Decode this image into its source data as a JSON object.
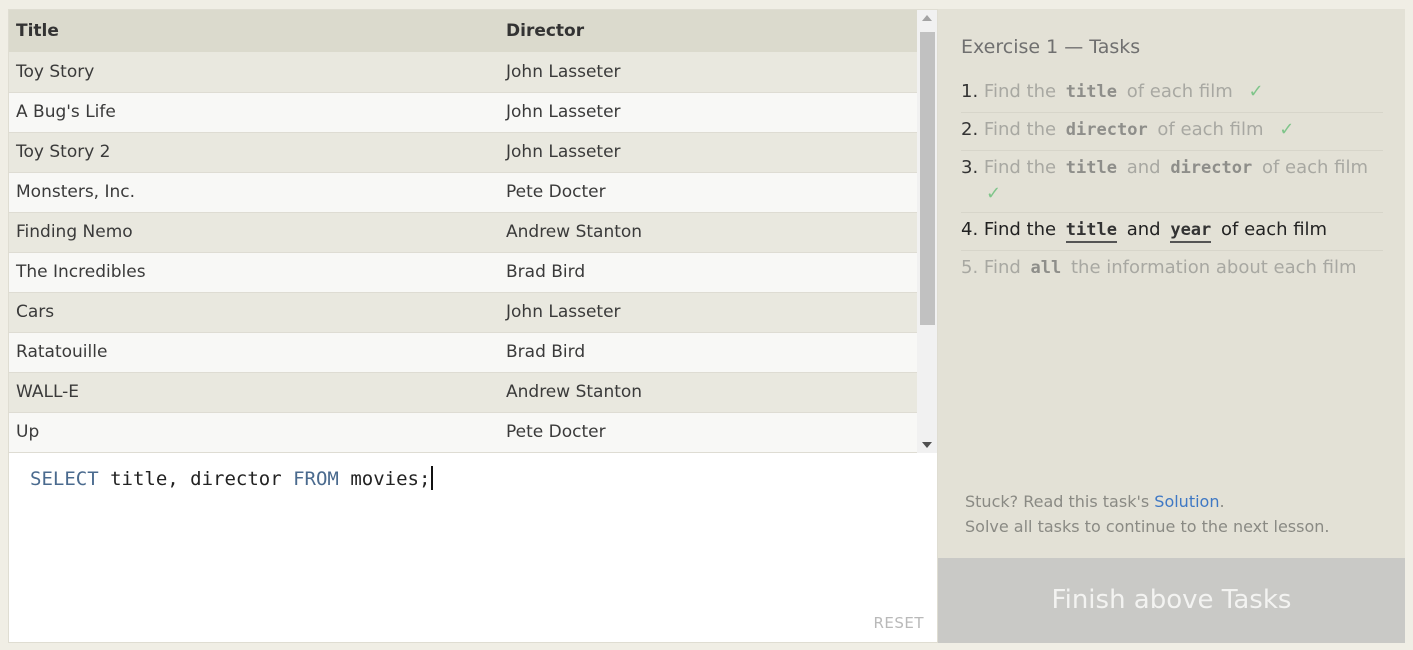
{
  "results": {
    "headers": {
      "title": "Title",
      "director": "Director"
    },
    "rows": [
      {
        "title": "Toy Story",
        "director": "John Lasseter"
      },
      {
        "title": "A Bug's Life",
        "director": "John Lasseter"
      },
      {
        "title": "Toy Story 2",
        "director": "John Lasseter"
      },
      {
        "title": "Monsters, Inc.",
        "director": "Pete Docter"
      },
      {
        "title": "Finding Nemo",
        "director": "Andrew Stanton"
      },
      {
        "title": "The Incredibles",
        "director": "Brad Bird"
      },
      {
        "title": "Cars",
        "director": "John Lasseter"
      },
      {
        "title": "Ratatouille",
        "director": "Brad Bird"
      },
      {
        "title": "WALL-E",
        "director": "Andrew Stanton"
      },
      {
        "title": "Up",
        "director": "Pete Docter"
      }
    ]
  },
  "editor": {
    "kw_select": "SELECT",
    "columns": " title, director ",
    "kw_from": "FROM",
    "table": " movies;",
    "reset_label": "RESET"
  },
  "exercise": {
    "title": "Exercise 1 — Tasks",
    "tasks": [
      {
        "num": "1.",
        "pre": "Find the",
        "code1": "title",
        "mid": "",
        "code2": "",
        "post": "of each film",
        "check": "✓"
      },
      {
        "num": "2.",
        "pre": "Find the",
        "code1": "director",
        "mid": "",
        "code2": "",
        "post": "of each film",
        "check": "✓"
      },
      {
        "num": "3.",
        "pre": "Find the",
        "code1": "title",
        "mid": "and",
        "code2": "director",
        "post": "of each film",
        "check": "✓"
      },
      {
        "num": "4.",
        "pre": "Find the",
        "code1": "title",
        "mid": "and",
        "code2": "year",
        "post": "of each film",
        "check": ""
      },
      {
        "num": "5.",
        "pre": "Find",
        "code1": "all",
        "mid": "",
        "code2": "",
        "post": "the information about each film",
        "check": ""
      }
    ]
  },
  "help": {
    "stuck_prefix": "Stuck? Read this task's ",
    "solution_link": "Solution",
    "stuck_suffix": ".",
    "continue_text": "Solve all tasks to continue to the next lesson."
  },
  "finish_button": "Finish above Tasks",
  "colors": {
    "accent_link": "#3f78c4",
    "check": "#7fc58a",
    "keyword": "#4a6a8e"
  }
}
